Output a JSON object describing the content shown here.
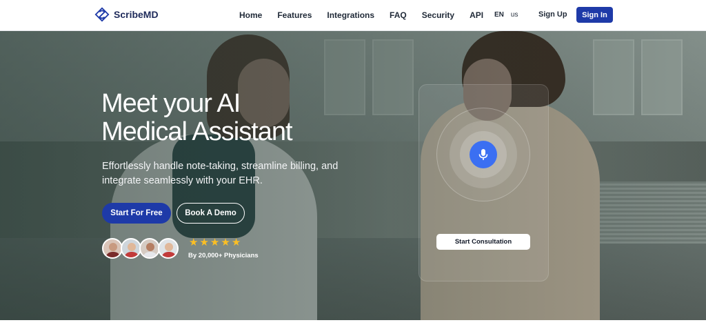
{
  "brand": {
    "name": "ScribeMD",
    "accent": "#1e3aa8"
  },
  "nav": {
    "links": [
      "Home",
      "Features",
      "Integrations",
      "FAQ",
      "Security",
      "API"
    ],
    "lang": {
      "code": "EN",
      "region": "us"
    },
    "signup_label": "Sign Up",
    "signin_label": "Sign In"
  },
  "hero": {
    "headline_line1": "Meet your AI",
    "headline_line2": "Medical Assistant",
    "subhead": "Effortlessly handle note-taking, streamline billing, and integrate seamlessly with your EHR.",
    "primary_cta": "Start For Free",
    "secondary_cta": "Book A Demo",
    "rating": {
      "stars": 5,
      "text": "By 20,000+ Physicians",
      "star_color": "#fbbf24"
    },
    "avatars": [
      "avatar-1",
      "avatar-2",
      "avatar-3",
      "avatar-4"
    ]
  },
  "consultation": {
    "mic_icon": "microphone-icon",
    "mic_color": "#3b6ff2",
    "button_label": "Start Consultation"
  }
}
